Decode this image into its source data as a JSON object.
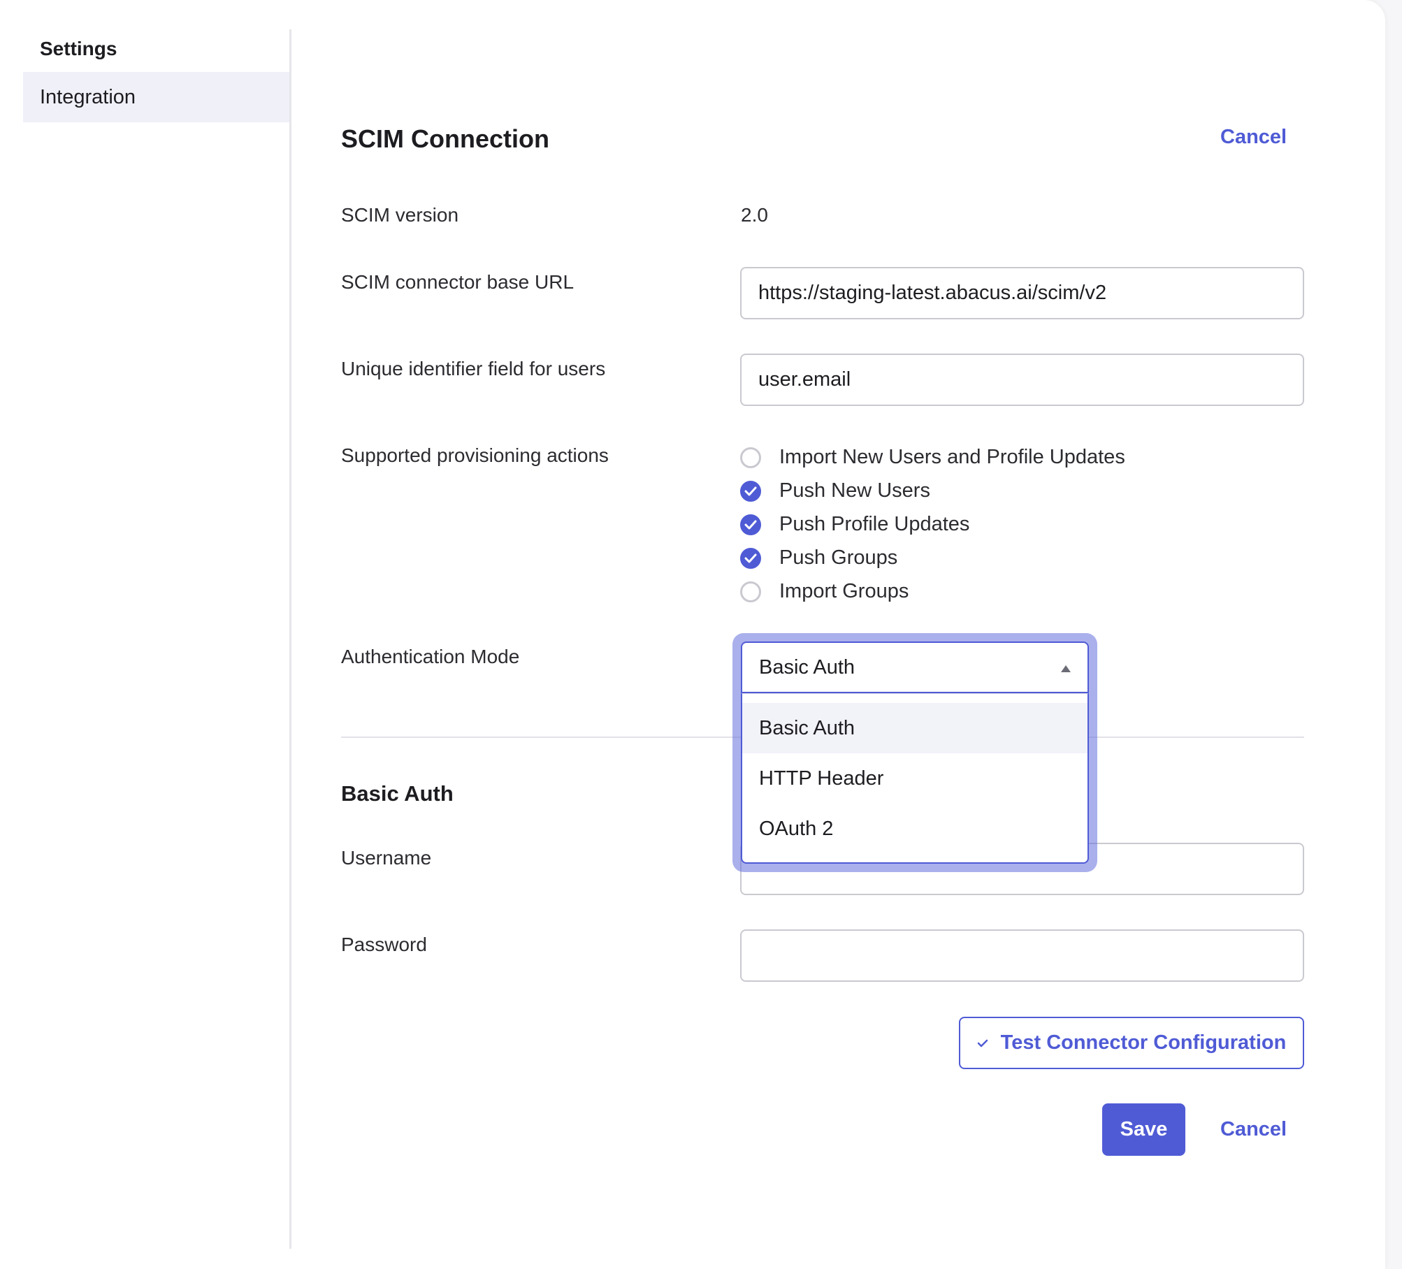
{
  "sidebar": {
    "title": "Settings",
    "items": [
      {
        "label": "Integration",
        "active": true
      }
    ]
  },
  "main": {
    "title": "SCIM Connection",
    "cancel_top": "Cancel",
    "fields": {
      "scim_version": {
        "label": "SCIM version",
        "value": "2.0"
      },
      "base_url": {
        "label": "SCIM connector base URL",
        "value": "https://staging-latest.abacus.ai/scim/v2"
      },
      "unique_id": {
        "label": "Unique identifier field for users",
        "value": "user.email"
      }
    },
    "provisioning": {
      "label": "Supported provisioning actions",
      "options": [
        {
          "label": "Import New Users and Profile Updates",
          "checked": false
        },
        {
          "label": "Push New Users",
          "checked": true
        },
        {
          "label": "Push Profile Updates",
          "checked": true
        },
        {
          "label": "Push Groups",
          "checked": true
        },
        {
          "label": "Import Groups",
          "checked": false
        }
      ]
    },
    "auth_mode": {
      "label": "Authentication Mode",
      "selected": "Basic Auth",
      "options": [
        "Basic Auth",
        "HTTP Header",
        "OAuth 2"
      ]
    },
    "basic_auth": {
      "title": "Basic Auth",
      "username_label": "Username",
      "username_value": "",
      "password_label": "Password",
      "password_value": ""
    },
    "test_button": "Test Connector Configuration",
    "save_button": "Save",
    "cancel_bottom": "Cancel"
  },
  "colors": {
    "accent": "#4f5bd5",
    "sidebar_active": "#f0f0f8",
    "border": "#c9c9d0"
  }
}
